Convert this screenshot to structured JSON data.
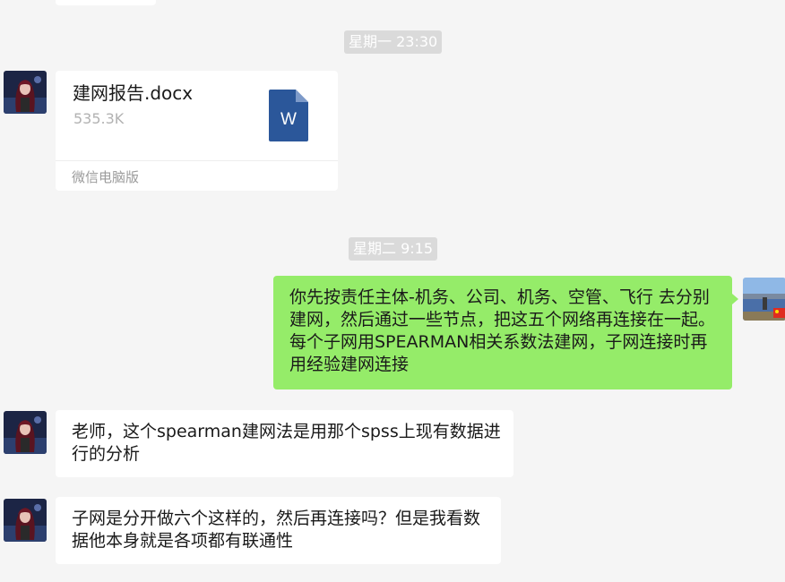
{
  "timestamps": [
    "星期一 23:30",
    "星期二 9:15"
  ],
  "file_message": {
    "file_name": "建网报告.docx",
    "file_size": "535.3K",
    "file_icon": "word-document-icon",
    "file_icon_letter": "W",
    "source": "微信电脑版"
  },
  "messages": [
    {
      "sender": "me",
      "text": "你先按责任主体-机务、公司、机务、空管、飞行 去分别建网，然后通过一些节点，把这五个网络再连接在一起。      每个子网用SPEARMAN相关系数法建网，子网连接时再用经验建网连接"
    },
    {
      "sender": "other",
      "text": "老师，这个spearman建网法是用那个spss上现有数据进行的分析"
    },
    {
      "sender": "other",
      "text": "子网是分开做六个这样的，然后再连接吗？但是我看数据他本身就是各项都有联通性"
    }
  ],
  "colors": {
    "background": "#f5f5f5",
    "my_bubble": "#95ec69",
    "other_bubble": "#ffffff",
    "timestamp_bg": "#dadada",
    "word_icon": "#2b579a"
  }
}
